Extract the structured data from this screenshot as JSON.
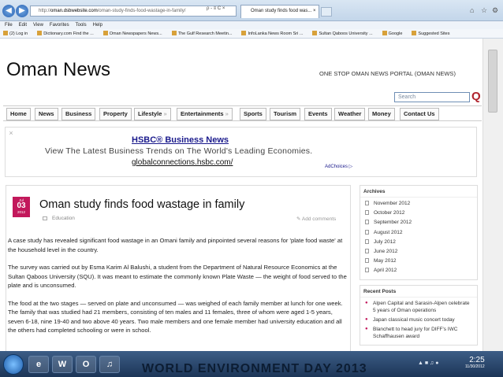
{
  "browser": {
    "url_domain": "oman.dsbwebsite.com",
    "url_path": "/oman-study-finds-food-wastage-in-family/",
    "addr_tools": "ρ - ≡ C ×",
    "tab_title": "Oman study finds food was...",
    "tab_close": "×",
    "menu": [
      "File",
      "Edit",
      "View",
      "Favorites",
      "Tools",
      "Help"
    ],
    "favorites": [
      "(2) Log in",
      "Dictionary.com Find the ...",
      "Oman Newspapers News...",
      "The Gulf Research Meetin...",
      "InfoLanka News Room Sri ...",
      "Sultan Qaboos University ...",
      "Google",
      "Suggested Sites"
    ]
  },
  "site": {
    "title": "Oman News",
    "tagline": "ONE STOP OMAN NEWS PORTAL (OMAN NEWS)",
    "search_placeholder": "Search",
    "search_button": "Q"
  },
  "nav": [
    {
      "label": "Home",
      "dropdown": false
    },
    {
      "label": "News",
      "dropdown": false
    },
    {
      "label": "Business",
      "dropdown": false
    },
    {
      "label": "Property",
      "dropdown": false
    },
    {
      "label": "Lifestyle",
      "dropdown": true
    },
    {
      "label": "Entertainments",
      "dropdown": true
    },
    {
      "label": "Sports",
      "dropdown": false
    },
    {
      "label": "Tourism",
      "dropdown": false
    },
    {
      "label": "Events",
      "dropdown": false
    },
    {
      "label": "Weather",
      "dropdown": false
    },
    {
      "label": "Money",
      "dropdown": false
    },
    {
      "label": "Contact Us",
      "dropdown": false
    }
  ],
  "ad": {
    "title": "HSBC® Business News",
    "text": "View The Latest Business Trends on The World's Leading Economies.",
    "url": "globalconnections.hsbc.com/",
    "choices": "AdChoices ▷",
    "close": "×"
  },
  "post": {
    "month": "Jul",
    "day": "03",
    "year": "2012",
    "title": "Oman study finds food wastage in family",
    "category": "Education",
    "add_comments": "Add comments",
    "paragraphs": [
      "A case study has revealed significant food wastage in an Omani family and pinpointed several reasons for 'plate food waste' at the household level in the country.",
      "The survey was carried out by Esma Karim Al Balushi, a student from the Department of Natural Resource Economics at the Sultan Qaboos University (SQU). It was  meant to estimate the commonly known Plate Waste — the weight of food served to the plate and is unconsumed.",
      "The food at the two stages — served on plate and unconsumed — was weighed of each family member at lunch for one week. The family that was studied had 21 members, consisting of ten males and 11 females, three of whom were aged 1-5 years, seven 6-18, nine 19-40 and two above 40 years. Two male members and one female member had university education and all the others had completed schooling or were in school."
    ]
  },
  "sidebar": {
    "archives_title": "Archives",
    "archives": [
      "November 2012",
      "October 2012",
      "September 2012",
      "August 2012",
      "July 2012",
      "June 2012",
      "May 2012",
      "April 2012"
    ],
    "recent_title": "Recent Posts",
    "recent": [
      "Alpen Capital and Sarasin-Alpen celebrate 5 years of Oman operations",
      "Japan classical music concert today",
      "Blanchett to head jury for DIFF's IWC Schaffhausen award"
    ]
  },
  "taskbar": {
    "apps": [
      "e",
      "W",
      "O",
      "♫"
    ],
    "clock_time": "2:25",
    "clock_date": "11/30/2012",
    "wallpaper_text": "WORLD ENVIRONMENT DAY 2013"
  }
}
